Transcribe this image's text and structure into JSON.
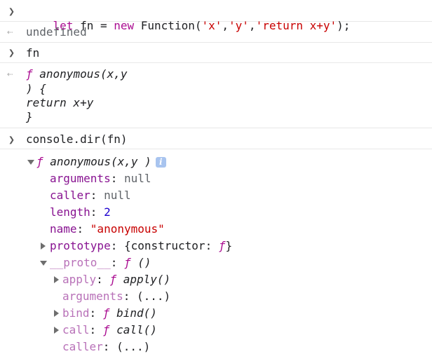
{
  "console": {
    "entry1": {
      "input": {
        "kw_let": "let",
        "var": " fn = ",
        "kw_new": "new",
        "fn_call": " Function(",
        "arg1": "'x'",
        "comma1": ",",
        "arg2": "'y'",
        "comma2": ",",
        "arg3": "'return x+y'",
        "close": ");"
      },
      "output": "undefined"
    },
    "entry2": {
      "input": "fn",
      "output": {
        "line1_f": "ƒ",
        "line1_rest": " anonymous(x,y",
        "line2": ") {",
        "line3": "return x+y",
        "line4": "}"
      }
    },
    "entry3": {
      "input": "console.dir(fn)",
      "tree": {
        "root_f": "ƒ",
        "root_label": " anonymous(x,y )",
        "info_icon": "i",
        "props": [
          {
            "key": "arguments",
            "sep": ": ",
            "value": "null"
          },
          {
            "key": "caller",
            "sep": ": ",
            "value": "null"
          },
          {
            "key": "length",
            "sep": ": ",
            "value": "2"
          },
          {
            "key": "name",
            "sep": ": ",
            "value": "\"anonymous\""
          }
        ],
        "prototype": {
          "key": "prototype",
          "sep": ": ",
          "value": "{constructor: ",
          "value_f": "ƒ",
          "value_end": "}"
        },
        "proto": {
          "key": "__proto__",
          "sep": ": ",
          "value_f": "ƒ",
          "value_end": " ()"
        },
        "proto_children": [
          {
            "key": "apply",
            "sep": ": ",
            "f": "ƒ",
            "fn": " apply()"
          },
          {
            "key": "arguments",
            "sep": ": ",
            "plain": "(...)"
          },
          {
            "key": "bind",
            "sep": ": ",
            "f": "ƒ",
            "fn": " bind()"
          },
          {
            "key": "call",
            "sep": ": ",
            "f": "ƒ",
            "fn": " call()"
          },
          {
            "key": "caller",
            "sep": ": ",
            "plain": "(...)"
          }
        ]
      }
    }
  },
  "icons": {
    "prompt": "prompt-chevron-icon",
    "result": "result-arrow-icon",
    "expand": "expand-triangle-icon",
    "collapse": "collapse-triangle-icon",
    "info": "info-icon"
  },
  "colors": {
    "keyword": "#aa0d91",
    "string": "#c80000",
    "number": "#1c00cf",
    "property": "#881391",
    "property_dim": "#b871b8",
    "info_badge": "#a8c4ef"
  }
}
